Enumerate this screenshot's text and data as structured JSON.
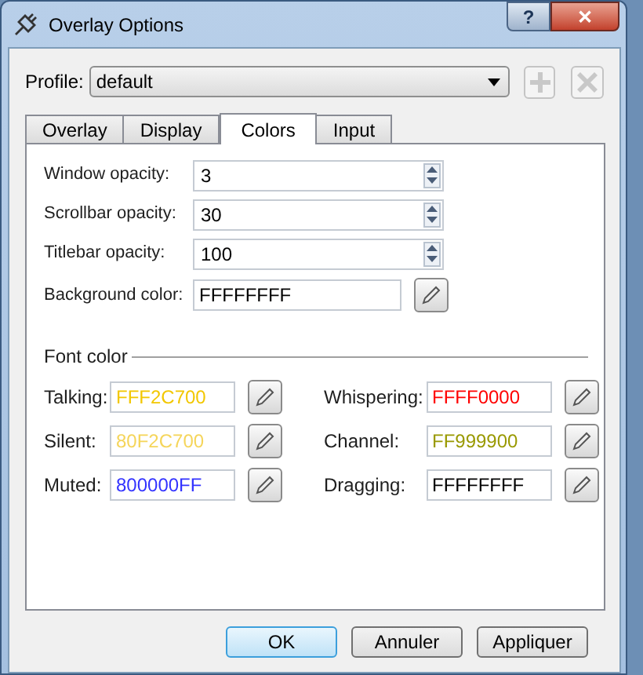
{
  "window": {
    "title": "Overlay Options"
  },
  "title_buttons": [
    "?",
    "✕"
  ],
  "profile": {
    "label": "Profile:",
    "value": "default"
  },
  "tabs": [
    {
      "label": "Overlay",
      "selected": false
    },
    {
      "label": "Display",
      "selected": false
    },
    {
      "label": "Colors",
      "selected": true
    },
    {
      "label": "Input",
      "selected": false
    }
  ],
  "spin_fields": [
    {
      "label": "Window opacity:",
      "value": "3"
    },
    {
      "label": "Scrollbar opacity:",
      "value": "30"
    },
    {
      "label": "Titlebar opacity:",
      "value": "100"
    }
  ],
  "background_color": {
    "label": "Background color:",
    "value": "FFFFFFFF"
  },
  "font_color": {
    "title": "Font color",
    "items": [
      {
        "label": "Talking:",
        "value": "FFF2C700",
        "color": "#f2c700"
      },
      {
        "label": "Whispering:",
        "value": "FFFF0000",
        "color": "#ff0000"
      },
      {
        "label": "Silent:",
        "value": "80F2C700",
        "color": "#f5d55a"
      },
      {
        "label": "Channel:",
        "value": "FF999900",
        "color": "#999900"
      },
      {
        "label": "Muted:",
        "value": "800000FF",
        "color": "#3333ff"
      },
      {
        "label": "Dragging:",
        "value": "FFFFFFFF",
        "color": "#000000"
      }
    ]
  },
  "buttons": [
    {
      "label": "OK",
      "default": true
    },
    {
      "label": "Annuler",
      "default": false
    },
    {
      "label": "Appliquer",
      "default": false
    }
  ]
}
